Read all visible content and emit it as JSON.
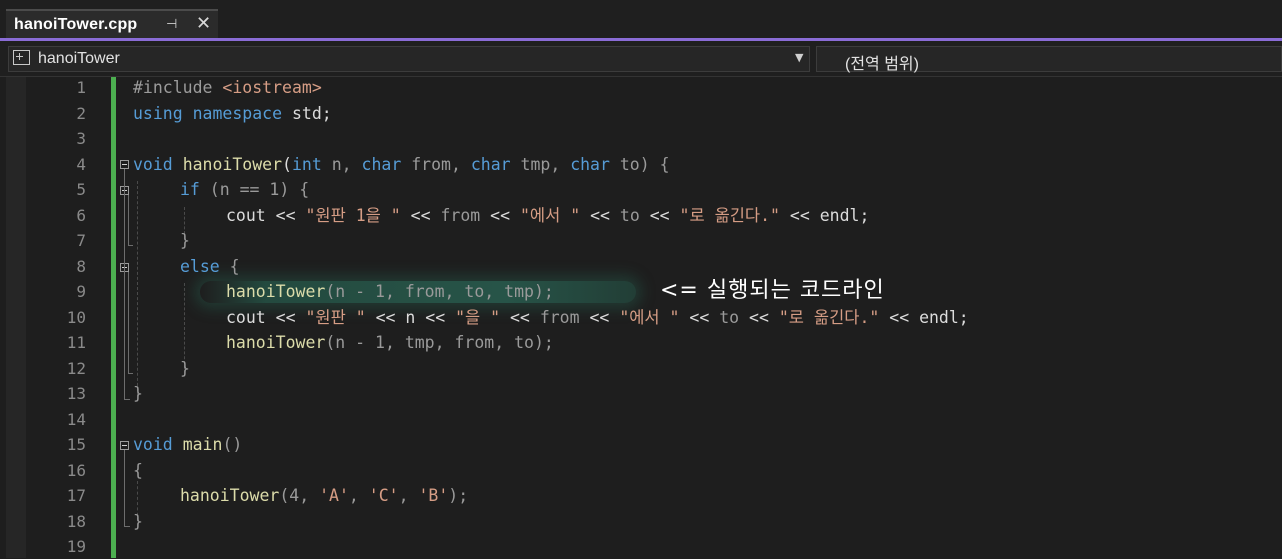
{
  "tab": {
    "title": "hanoiTower.cpp",
    "pin_icon": "pin-icon",
    "close_icon": "close-icon"
  },
  "nav": {
    "scope": "hanoiTower",
    "global_scope": "(전역 범위)",
    "dropdown_icon": "chevron-down-icon"
  },
  "colors": {
    "accent": "#8a6cd6",
    "keyword": "#569cd6",
    "function": "#dcdcaa",
    "string": "#d69d85",
    "change_bar": "#4caf50"
  },
  "annotation": "<= 실행되는 코드라인",
  "highlighted_line": 9,
  "code": {
    "line_numbers": [
      "1",
      "2",
      "3",
      "4",
      "5",
      "6",
      "7",
      "8",
      "9",
      "10",
      "11",
      "12",
      "13",
      "14",
      "15",
      "16",
      "17",
      "18",
      "19"
    ],
    "l1": {
      "a": "#include",
      "b": " <iostream>"
    },
    "l2": {
      "a": "using",
      "b": " ",
      "c": "namespace",
      "d": " std;"
    },
    "l4": {
      "a": "void",
      "b": " ",
      "c": "hanoiTower",
      "d": "(",
      "e": "int",
      "f": " n, ",
      "g": "char",
      "h": " from, ",
      "i": "char",
      "j": " tmp, ",
      "k": "char",
      "l": " to) {"
    },
    "l5": {
      "a": "if",
      "b": " (n == 1) {"
    },
    "l6": {
      "a": "cout",
      "b": " << ",
      "c": "\"원판 1을 \"",
      "d": " << ",
      "e": "from",
      "f": " << ",
      "g": "\"에서 \"",
      "h": " << ",
      "i": "to",
      "j": " << ",
      "k": "\"로 옮긴다.\"",
      "l": " << endl;"
    },
    "l7": {
      "a": "}"
    },
    "l8": {
      "a": "else",
      "b": " {"
    },
    "l9": {
      "a": "hanoiTower",
      "b": "(n - 1, from, to, tmp);"
    },
    "l10": {
      "a": "cout",
      "b": " << ",
      "c": "\"원판 \"",
      "d": " << n << ",
      "e": "\"을 \"",
      "f": " << ",
      "g": "from",
      "h": " << ",
      "i": "\"에서 \"",
      "j": " << ",
      "k": "to",
      "l": " << ",
      "m": "\"로 옮긴다.\"",
      "n": " << endl;"
    },
    "l11": {
      "a": "hanoiTower",
      "b": "(n - 1, tmp, from, to);"
    },
    "l12": {
      "a": "}"
    },
    "l13": {
      "a": "}"
    },
    "l15": {
      "a": "void",
      "b": " ",
      "c": "main",
      "d": "()"
    },
    "l16": {
      "a": "{"
    },
    "l17": {
      "a": "hanoiTower",
      "b": "(4, ",
      "c": "'A'",
      "d": ", ",
      "e": "'C'",
      "f": ", ",
      "g": "'B'",
      "h": ");"
    },
    "l18": {
      "a": "}"
    }
  }
}
